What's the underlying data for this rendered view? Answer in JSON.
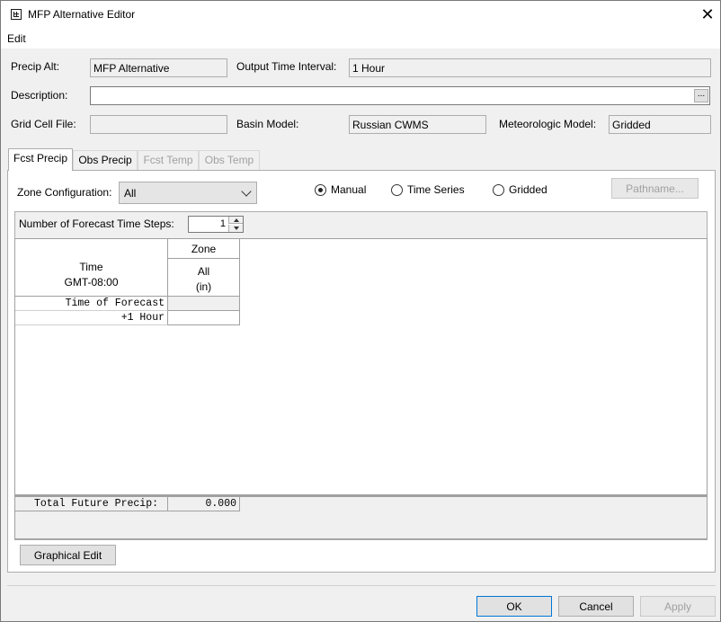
{
  "window": {
    "title": "MFP Alternative Editor",
    "close_glyph": "✕"
  },
  "menu": {
    "edit": "Edit"
  },
  "form": {
    "precip_alt_label": "Precip Alt:",
    "precip_alt_value": "MFP Alternative",
    "output_interval_label": "Output Time Interval:",
    "output_interval_value": "1 Hour",
    "description_label": "Description:",
    "description_value": "",
    "description_button": "...",
    "grid_cell_label": "Grid Cell File:",
    "grid_cell_value": "",
    "basin_model_label": "Basin Model:",
    "basin_model_value": "Russian CWMS",
    "met_model_label": "Meteorologic Model:",
    "met_model_value": "Gridded"
  },
  "tabs": [
    {
      "label": "Fcst Precip",
      "state": "active"
    },
    {
      "label": "Obs Precip",
      "state": "enabled"
    },
    {
      "label": "Fcst Temp",
      "state": "disabled"
    },
    {
      "label": "Obs Temp",
      "state": "disabled"
    }
  ],
  "zone": {
    "label": "Zone Configuration:",
    "selected": "All"
  },
  "radios": [
    {
      "label": "Manual",
      "checked": true
    },
    {
      "label": "Time Series",
      "checked": false
    },
    {
      "label": "Gridded",
      "checked": false
    }
  ],
  "pathname_button": "Pathname...",
  "timesteps": {
    "label": "Number of Forecast Time Steps:",
    "value": "1"
  },
  "table": {
    "time_header_line1": "Time",
    "time_header_line2": "GMT-08:00",
    "zone_header": "Zone",
    "col_name": "All",
    "col_unit": "(in)",
    "rows": [
      {
        "label": "Time of Forecast",
        "value": ""
      },
      {
        "label": "+1 Hour",
        "value": ""
      }
    ],
    "total_label": "Total Future Precip:",
    "total_value": "0.000"
  },
  "graphical_edit_button": "Graphical Edit",
  "footer": {
    "ok": "OK",
    "cancel": "Cancel",
    "apply": "Apply"
  }
}
